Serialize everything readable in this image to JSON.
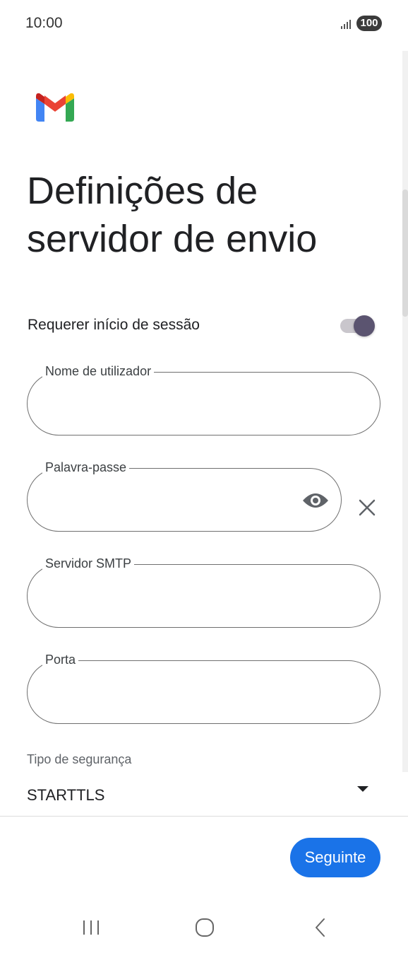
{
  "status_bar": {
    "time": "10:00",
    "battery": "100",
    "signal_icon": "signal-bars-icon"
  },
  "app": {
    "logo": "gmail-logo",
    "brand_colors": {
      "blue": "#4285F4",
      "red": "#EA4335",
      "yellow": "#FBBC04",
      "green": "#34A853"
    }
  },
  "page": {
    "title": "Definições de servidor de envio"
  },
  "form": {
    "require_signin_label": "Requerer início de sessão",
    "require_signin_on": true,
    "username": {
      "label": "Nome de utilizador",
      "value": ""
    },
    "password": {
      "label": "Palavra-passe",
      "value": "",
      "visibility_icon": "eye-icon",
      "clear_icon": "close-icon"
    },
    "smtp_server": {
      "label": "Servidor SMTP",
      "value": ""
    },
    "port": {
      "label": "Porta",
      "value": ""
    },
    "security_type": {
      "label": "Tipo de segurança",
      "value": "STARTTLS",
      "dropdown_icon": "dropdown-arrow-icon"
    }
  },
  "footer": {
    "next_label": "Seguinte",
    "next_color": "#1a73e8"
  },
  "nav_bar": {
    "recent_icon": "recent-apps-icon",
    "home_icon": "home-icon",
    "back_icon": "back-icon"
  }
}
